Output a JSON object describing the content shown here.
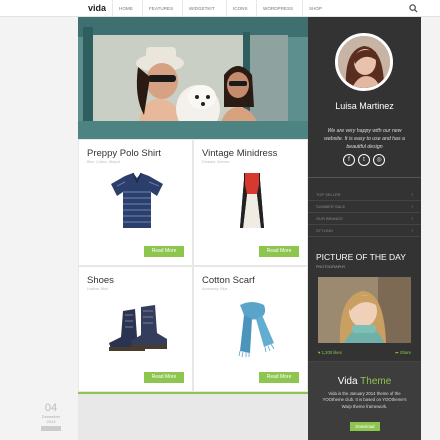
{
  "nav": {
    "logo": "vida",
    "items": [
      "HOME",
      "FEATURES",
      "WIDGETKIT",
      "ICONS",
      "WORDPRESS",
      "SHOP"
    ]
  },
  "products": [
    {
      "title": "Preppy Polo Shirt",
      "subtitle": "Blue, Cotton, Striped",
      "button": "Read More"
    },
    {
      "title": "Vintage Minidress",
      "subtitle": "Dresses, Women",
      "button": "Read More"
    },
    {
      "title": "Shoes",
      "subtitle": "Leather, Blue",
      "button": "Read More"
    },
    {
      "title": "Cotton Scarf",
      "subtitle": "Accessory, Blue",
      "button": "Read More"
    }
  ],
  "date": {
    "day": "04",
    "month": "December",
    "year": "2013"
  },
  "sidebar": {
    "name": "Luisa Martinez",
    "bio": "We are very happy with our new website. It is easy to use and has a beautiful design",
    "social_icons": [
      "facebook-icon",
      "twitter-icon",
      "dribbble-icon"
    ],
    "menu": [
      "TOP SELLER",
      "SUMMER SALE",
      "OUR BRANDS",
      "STYLING"
    ],
    "potd": {
      "title": "PICTURE OF THE DAY",
      "subtitle": "PHOTOGRAPHY",
      "likes": "1,200 likes",
      "share": "Share"
    },
    "vida": {
      "title_main": "Vida",
      "title_accent": "Theme",
      "description": "Vida is the January 2014 theme of the YOOtheme club. It is based on YOOtheme's Warp theme framework.",
      "button": "Download"
    }
  },
  "colors": {
    "accent": "#8dc54f",
    "sidebar": "#333333"
  }
}
